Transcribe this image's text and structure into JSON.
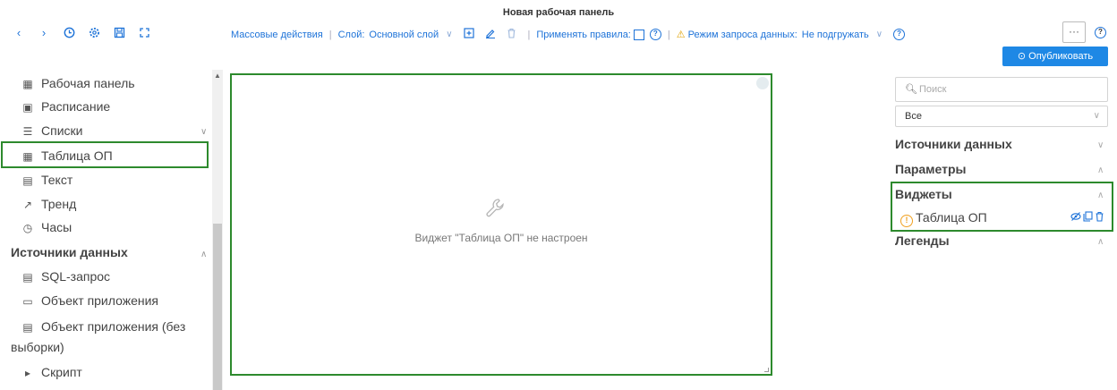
{
  "header": {
    "title": "Новая рабочая панель",
    "nav_icons": [
      "chevron-left-icon",
      "chevron-right-icon",
      "history-icon",
      "settings-icon",
      "save-icon",
      "fullscreen-icon"
    ]
  },
  "toolbar": {
    "bulk_actions": "Массовые действия",
    "layer_label": "Слой:",
    "layer_value": "Основной слой",
    "apply_rules_label": "Применять правила:",
    "data_mode_label": "Режим запроса данных:",
    "data_mode_value": "Не подгружать",
    "more": "···",
    "publish": "Опубликовать"
  },
  "left_panel": {
    "widgets": [
      {
        "icon": "dashboard-icon",
        "glyph": "▦",
        "label": "Рабочая панель"
      },
      {
        "icon": "calendar-icon",
        "glyph": "▣",
        "label": "Расписание"
      },
      {
        "icon": "list-icon",
        "glyph": "☰",
        "label": "Списки"
      },
      {
        "icon": "table-icon",
        "glyph": "▦",
        "label": "Таблица ОП"
      },
      {
        "icon": "text-icon",
        "glyph": "▤",
        "label": "Текст"
      },
      {
        "icon": "trend-icon",
        "glyph": "↗",
        "label": "Тренд"
      },
      {
        "icon": "clock-icon",
        "glyph": "◷",
        "label": "Часы"
      }
    ],
    "sources_title": "Источники данных",
    "sources": [
      {
        "icon": "sql-icon",
        "glyph": "▤",
        "label": "SQL-запрос"
      },
      {
        "icon": "app-object-icon",
        "glyph": "▭",
        "label": "Объект приложения"
      },
      {
        "icon": "app-object-nosel-icon",
        "glyph": "▤",
        "label": "Объект приложения (без"
      },
      {
        "icon": "",
        "glyph": "",
        "label": "выборки)"
      },
      {
        "icon": "script-icon",
        "glyph": "▸",
        "label": "Скрипт"
      }
    ]
  },
  "canvas": {
    "message": "Виджет \"Таблица ОП\" не настроен"
  },
  "right_panel": {
    "search_placeholder": "Поиск",
    "filter_value": "Все",
    "sections": {
      "sources": "Источники данных",
      "params": "Параметры",
      "widgets": "Виджеты",
      "legends": "Легенды"
    },
    "widget_item": "Таблица ОП"
  }
}
